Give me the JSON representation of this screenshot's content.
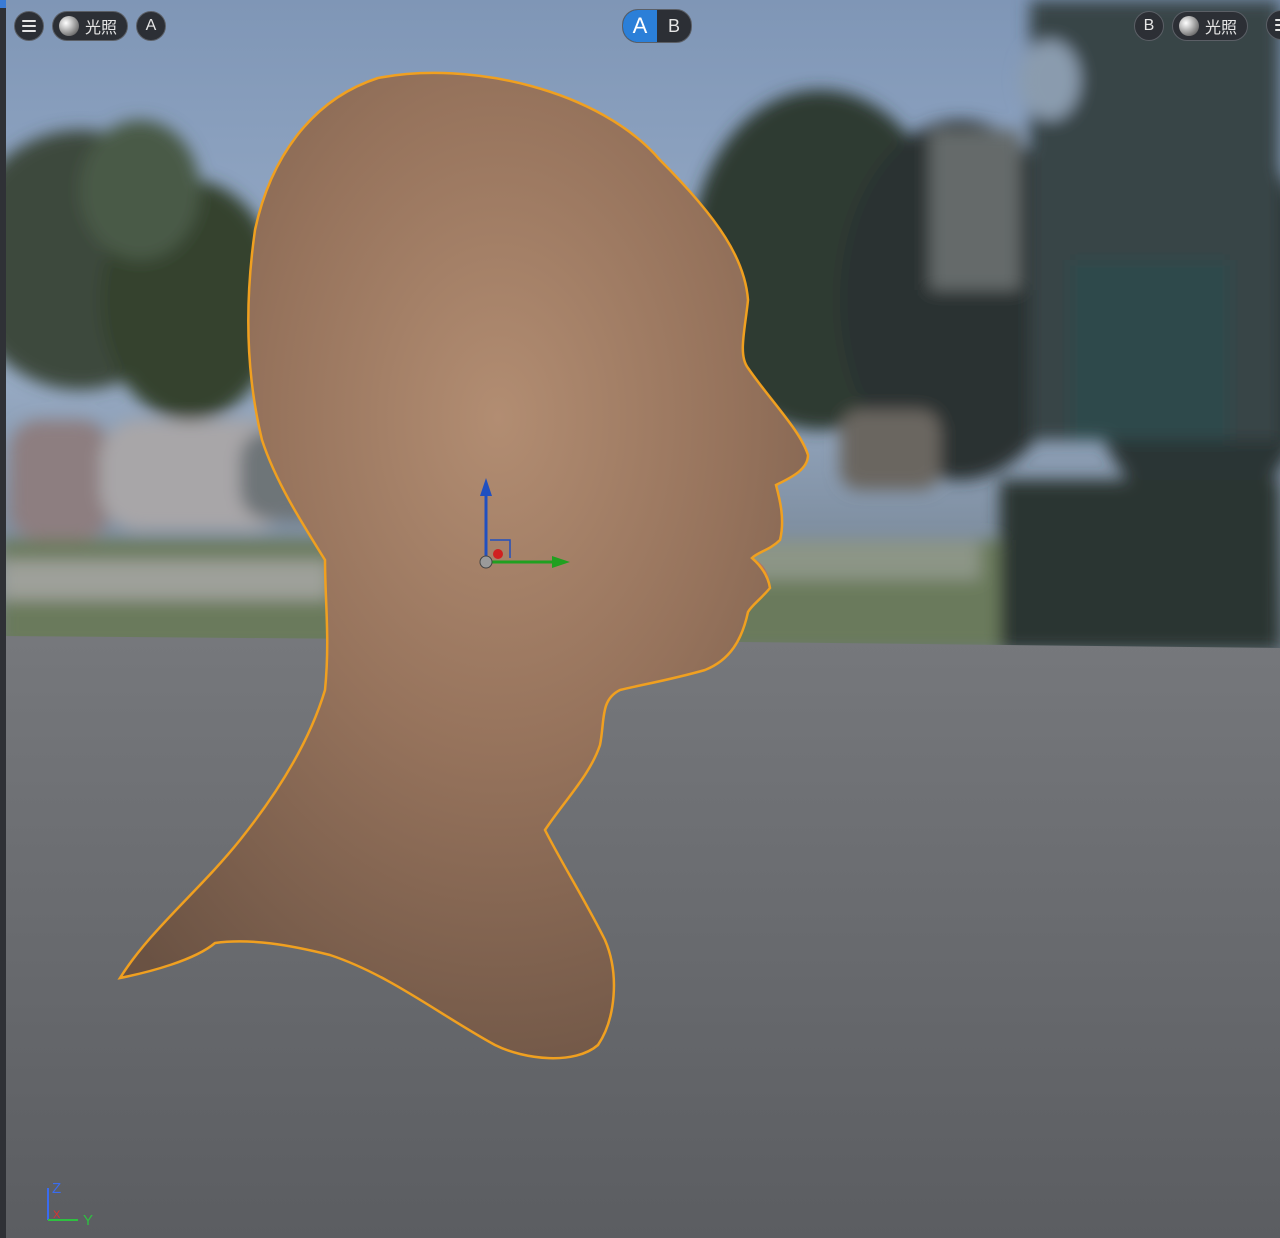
{
  "toolbar_left": {
    "menu_icon": "hamburger-menu-icon",
    "lighting_label": "光照",
    "lighting_icon": "light-sphere-icon",
    "view_label": "A"
  },
  "compare_toggle": {
    "a_label": "A",
    "b_label": "B",
    "active": "A",
    "active_color": "#2b7fd8"
  },
  "toolbar_right": {
    "view_label": "B",
    "lighting_label": "光照",
    "lighting_icon": "light-sphere-icon",
    "menu_icon": "hamburger-menu-icon"
  },
  "viewport": {
    "selection_outline_color": "#f0a020",
    "gizmo_colors": {
      "x": "#d02020",
      "y": "#20a020",
      "z": "#2050c0"
    }
  },
  "axis_triad": {
    "z_label": "Z",
    "y_label": "Y",
    "x_label": "X",
    "z_color": "#3a6cf0",
    "y_color": "#2ec040",
    "x_color": "#e03030"
  }
}
